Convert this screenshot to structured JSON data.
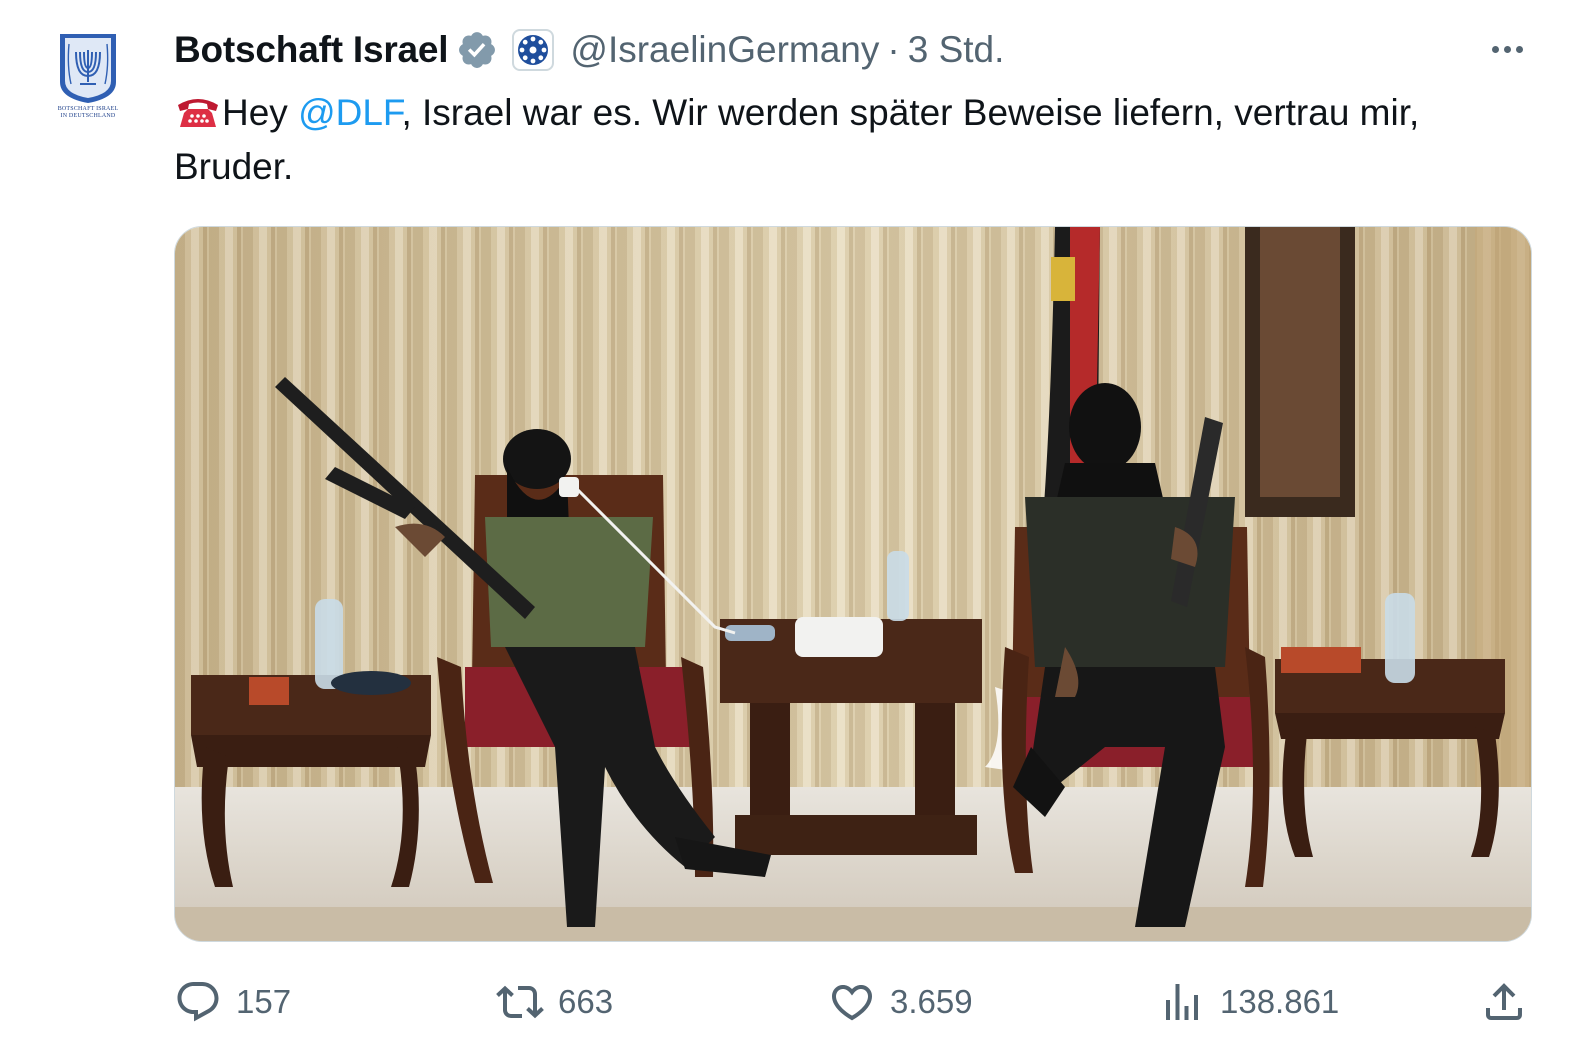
{
  "tweet": {
    "author": {
      "display_name": "Botschaft Israel",
      "handle": "@IsraelinGermany",
      "separator": "·",
      "time": "3 Std.",
      "avatar_caption_line1": "BOTSCHAFT ISRAEL",
      "avatar_caption_line2": "IN DEUTSCHLAND",
      "verified_icon": "verified-badge-icon",
      "affiliate_icon": "government-affiliate-icon"
    },
    "text": {
      "emoji": "telephone-emoji",
      "prefix": "Hey ",
      "mention": "@DLF",
      "suffix": ", Israel war es. Wir werden später Beweise liefern, vertrau mir, Bruder."
    },
    "media": {
      "type": "photo",
      "icon": "photo-icon"
    },
    "stats": {
      "replies": "157",
      "retweets": "663",
      "likes": "3.659",
      "views": "138.861"
    }
  },
  "colors": {
    "text_primary": "#0f1419",
    "text_secondary": "#536471",
    "link": "#1d9bf0",
    "verified_badge": "#829aab"
  }
}
